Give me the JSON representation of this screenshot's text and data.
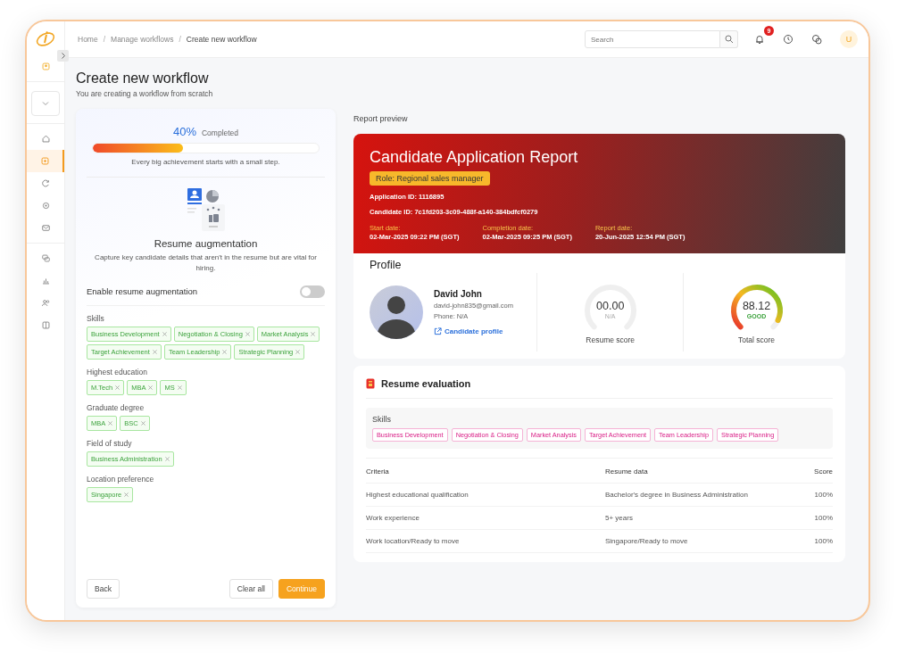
{
  "sidebar": {
    "items": [
      {
        "selected": false
      },
      {
        "selected": false
      },
      {
        "selected": true
      },
      {
        "selected": false
      },
      {
        "selected": false
      },
      {
        "selected": false
      },
      {
        "selected": false
      },
      {
        "selected": false
      },
      {
        "selected": false
      },
      {
        "selected": false
      }
    ]
  },
  "breadcrumb": {
    "items": [
      "Home",
      "Manage workflows",
      "Create new workflow"
    ],
    "separator": "/"
  },
  "search": {
    "placeholder": "Search"
  },
  "notifications": {
    "count": "9"
  },
  "user": {
    "initial": "U"
  },
  "page": {
    "title": "Create new workflow",
    "subtitle": "You are creating a workflow from scratch"
  },
  "progress": {
    "percent": "40%",
    "label": "Completed",
    "level": 0.4,
    "motto": "Every big achievement starts with a small step."
  },
  "augmentation": {
    "title": "Resume augmentation",
    "description": "Capture key candidate details that aren't in the resume but are vital for hiring.",
    "toggle_label": "Enable resume augmentation",
    "on": false
  },
  "fields": [
    {
      "label": "Skills",
      "chips": [
        "Business Development",
        "Negotiation & Closing",
        "Market Analysis",
        "Target Achievement",
        "Team Leadership",
        "Strategic Planning"
      ]
    },
    {
      "label": "Highest education",
      "chips": [
        "M.Tech",
        "MBA",
        "MS"
      ]
    },
    {
      "label": "Graduate degree",
      "chips": [
        "MBA",
        "BSC"
      ]
    },
    {
      "label": "Field of study",
      "chips": [
        "Business Administration"
      ]
    },
    {
      "label": "Location preference",
      "chips": [
        "Singapore"
      ]
    }
  ],
  "buttons": {
    "back": "Back",
    "clear": "Clear all",
    "continue": "Continue"
  },
  "preview": {
    "label": "Report preview",
    "report": {
      "title": "Candidate Application Report",
      "role": "Role: Regional sales manager",
      "ids": [
        {
          "label": "Application ID: ",
          "value": "1116895"
        },
        {
          "label": "Candidate ID: ",
          "value": "7c1fd203-3c09-488f-a140-384bdfcf0279"
        }
      ],
      "dates": [
        {
          "label": "Start date:",
          "value": "02-Mar-2025 09:22 PM (SGT)"
        },
        {
          "label": "Completion date:",
          "value": "02-Mar-2025 09:25 PM (SGT)"
        },
        {
          "label": "Report date:",
          "value": "20-Jun-2025 12:54 PM (SGT)"
        }
      ]
    },
    "profile": {
      "heading": "Profile",
      "name": "David John",
      "email": "david-john835@gmail.com",
      "phone": "Phone: N/A",
      "link": "Candidate profile",
      "scores": [
        {
          "value": "00.00",
          "rating": "N/A",
          "label": "Resume score",
          "kind": "plain"
        },
        {
          "value": "88.12",
          "rating": "GOOD",
          "label": "Total score",
          "kind": "graded"
        }
      ]
    },
    "evaluation": {
      "heading": "Resume evaluation",
      "skills_label": "Skills",
      "skills": [
        "Business Development",
        "Negotiation & Closing",
        "Market Analysis",
        "Target Achievement",
        "Team Leadership",
        "Strategic Planning"
      ],
      "columns": [
        "Criteria",
        "Resume data",
        "Score"
      ],
      "rows": [
        [
          "Highest educational qualification",
          "Bachelor's degree in Business Administration",
          "100%"
        ],
        [
          "Work experience",
          "5+ years",
          "100%"
        ],
        [
          "Work location/Ready to move",
          "Singapore/Ready to move",
          "100%"
        ]
      ]
    }
  }
}
